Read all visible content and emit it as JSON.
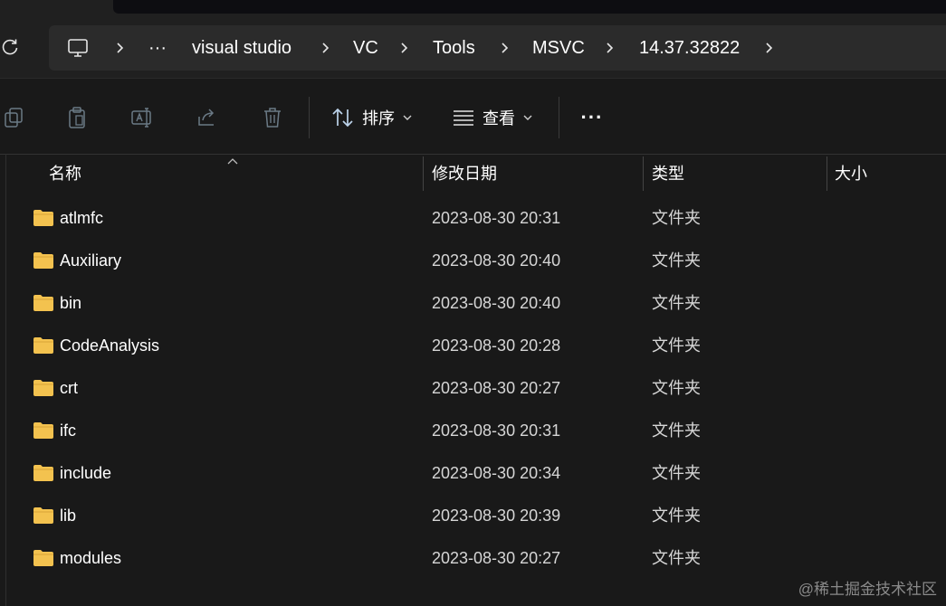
{
  "address_bar": {
    "overflow_label": "···",
    "crumbs": [
      "visual studio",
      "VC",
      "Tools",
      "MSVC",
      "14.37.32822"
    ]
  },
  "toolbar": {
    "sort_label": "排序",
    "view_label": "查看",
    "more_label": "···"
  },
  "columns": {
    "name": "名称",
    "date": "修改日期",
    "type": "类型",
    "size": "大小"
  },
  "files": [
    {
      "name": "atlmfc",
      "date": "2023-08-30 20:31",
      "type": "文件夹"
    },
    {
      "name": "Auxiliary",
      "date": "2023-08-30 20:40",
      "type": "文件夹"
    },
    {
      "name": "bin",
      "date": "2023-08-30 20:40",
      "type": "文件夹"
    },
    {
      "name": "CodeAnalysis",
      "date": "2023-08-30 20:28",
      "type": "文件夹"
    },
    {
      "name": "crt",
      "date": "2023-08-30 20:27",
      "type": "文件夹"
    },
    {
      "name": "ifc",
      "date": "2023-08-30 20:31",
      "type": "文件夹"
    },
    {
      "name": "include",
      "date": "2023-08-30 20:34",
      "type": "文件夹"
    },
    {
      "name": "lib",
      "date": "2023-08-30 20:39",
      "type": "文件夹"
    },
    {
      "name": "modules",
      "date": "2023-08-30 20:27",
      "type": "文件夹"
    }
  ],
  "watermark": "@稀土掘金技术社区",
  "colors": {
    "background": "#191919",
    "address_bar": "#2b2b2b",
    "folder": "#f3c24f"
  }
}
